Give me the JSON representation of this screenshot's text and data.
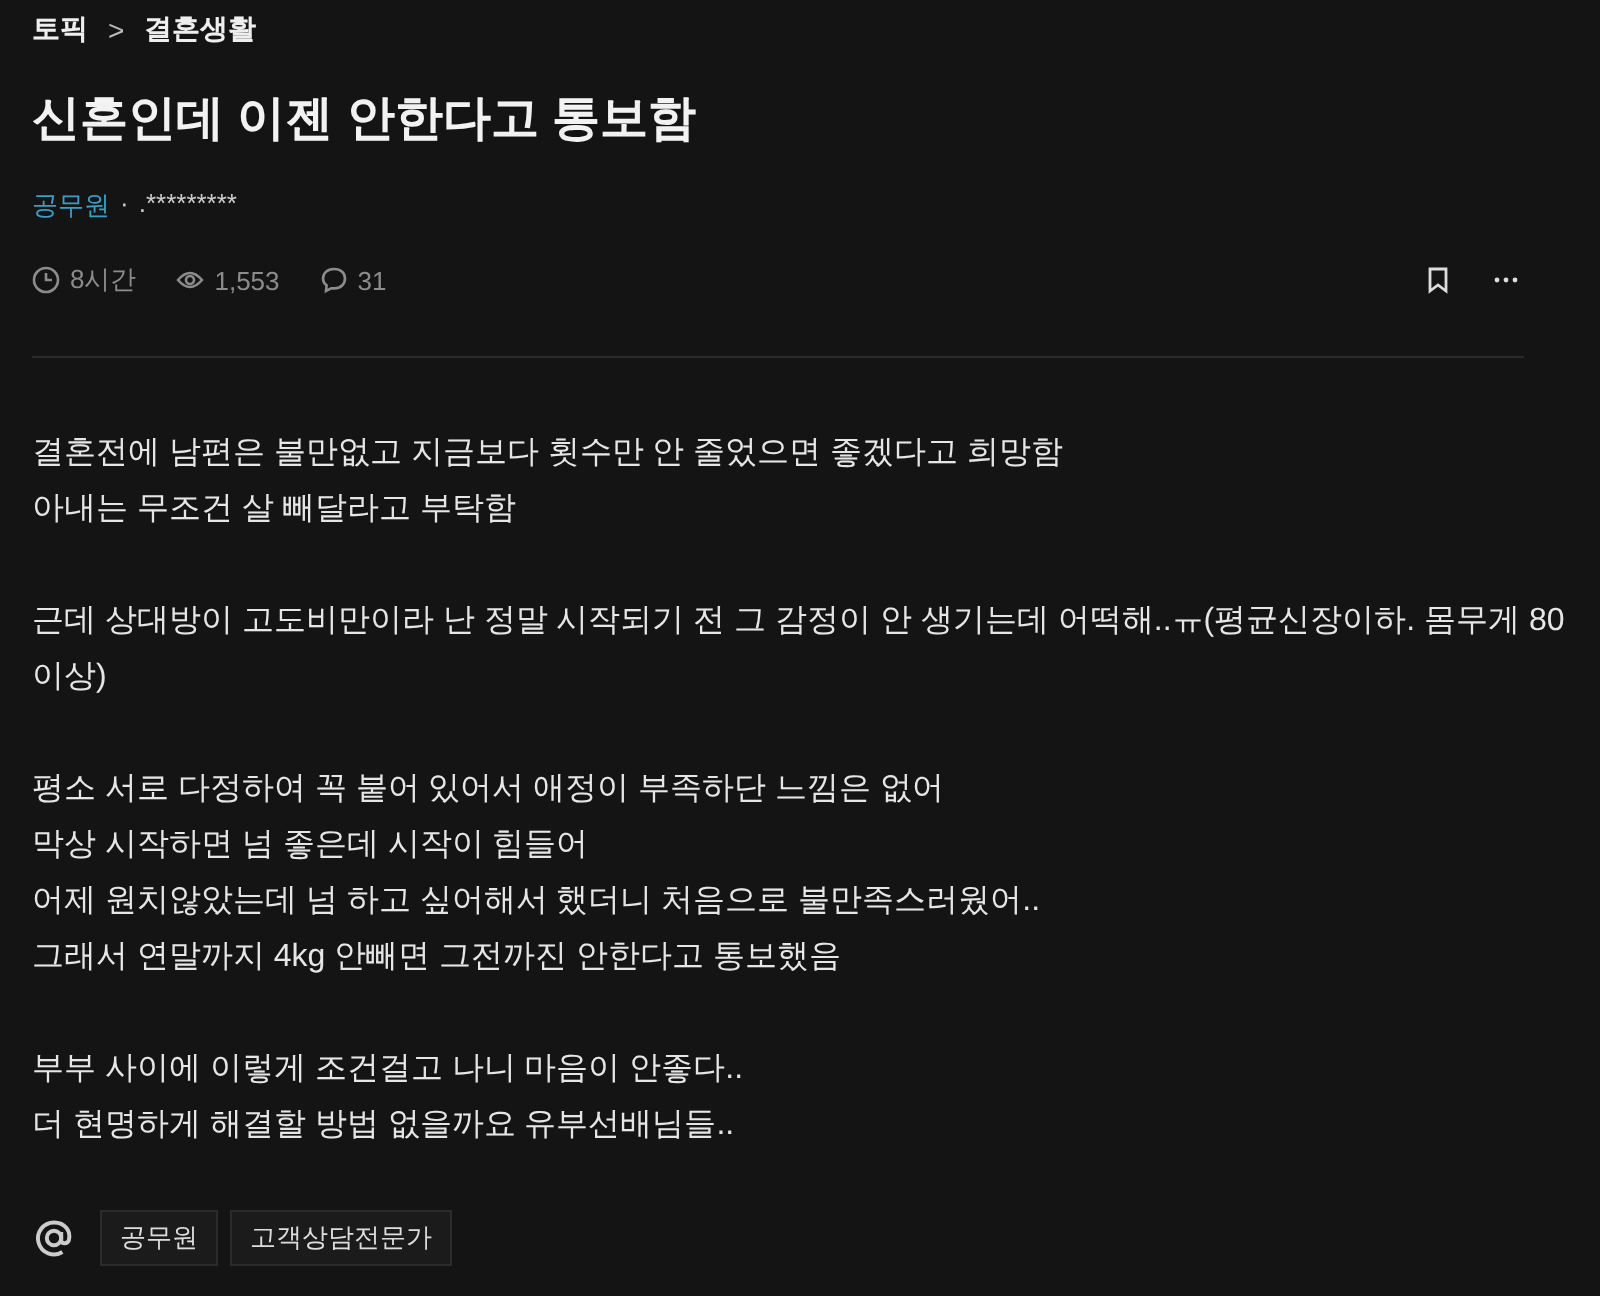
{
  "breadcrumb": {
    "topic": "토픽",
    "separator": ">",
    "category": "결혼생활"
  },
  "title": "신혼인데 이젠 안한다고 통보함",
  "author": {
    "job": "공무원",
    "separator": "·",
    "name": ".*********"
  },
  "meta": {
    "time": "8시간",
    "views": "1,553",
    "comments": "31"
  },
  "body": [
    [
      "결혼전에 남편은 불만없고 지금보다 횟수만 안 줄었으면 좋겠다고 희망함",
      "아내는 무조건 살 빼달라고 부탁함"
    ],
    [
      "근데 상대방이 고도비만이라 난 정말 시작되기 전 그 감정이 안 생기는데 어떡해..ㅠ(평균신장이하. 몸무게 80이상)"
    ],
    [
      "평소 서로 다정하여 꼭 붙어 있어서 애정이 부족하단 느낌은 없어",
      "막상 시작하면 넘 좋은데 시작이 힘들어",
      "어제 원치않았는데 넘 하고 싶어해서 했더니 처음으로 불만족스러웠어..",
      "그래서 연말까지 4kg 안빼면 그전까진 안한다고 통보했음"
    ],
    [
      "부부 사이에 이렇게 조건걸고 나니 마음이 안좋다..",
      "더 현명하게 해결할 방법 없을까요 유부선배님들.."
    ]
  ],
  "tags": [
    "공무원",
    "고객상담전문가"
  ]
}
